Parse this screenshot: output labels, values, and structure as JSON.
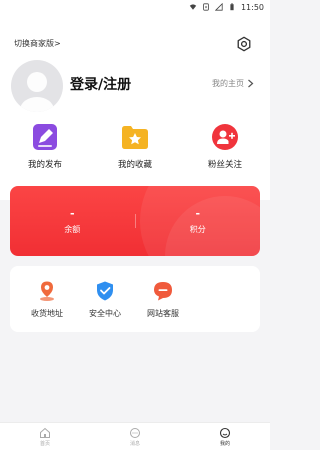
{
  "status_bar": {
    "time": "11:50",
    "icons": [
      "wifi-icon",
      "sim-icon",
      "signal-icon",
      "battery-icon"
    ]
  },
  "header": {
    "switch_label": "切换商家版>",
    "settings_icon": "gear-icon"
  },
  "profile": {
    "login_label": "登录/注册",
    "homepage_label": "我的主页"
  },
  "quick_actions": [
    {
      "label": "我的发布",
      "icon": "edit-document-icon",
      "color": "#8b4be0"
    },
    {
      "label": "我的收藏",
      "icon": "star-folder-icon",
      "color": "#f5b323"
    },
    {
      "label": "粉丝关注",
      "icon": "follow-user-icon",
      "color": "#f0343c"
    }
  ],
  "stats": {
    "balance": {
      "value": "-",
      "label": "余额"
    },
    "points": {
      "value": "-",
      "label": "积分"
    },
    "card_color": "#f53a3e"
  },
  "services": [
    {
      "label": "收货地址",
      "icon": "location-pin-icon",
      "color": "#f06a3c"
    },
    {
      "label": "安全中心",
      "icon": "shield-check-icon",
      "color": "#2f8ff0"
    },
    {
      "label": "网站客服",
      "icon": "chat-bubble-icon",
      "color": "#f05a3c"
    }
  ],
  "tabbar": {
    "tabs": [
      {
        "label": "首页",
        "icon": "home-icon",
        "active": false
      },
      {
        "label": "消息",
        "icon": "message-icon",
        "active": false
      },
      {
        "label": "我的",
        "icon": "profile-icon",
        "active": true
      }
    ]
  }
}
